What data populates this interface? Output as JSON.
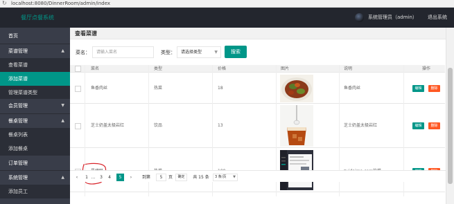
{
  "browser": {
    "url": "localhost:8080/DinnerRoom/admin/index"
  },
  "header": {
    "logo": "餐厅点餐系统",
    "user": "系统管理员（admin）",
    "logout": "退出系统"
  },
  "sidebar": {
    "items": [
      {
        "label": "首页",
        "type": "group",
        "caret": ""
      },
      {
        "label": "菜谱管理",
        "type": "group",
        "caret": "▲"
      },
      {
        "label": "查看菜谱",
        "type": "sub",
        "caret": ""
      },
      {
        "label": "添加菜谱",
        "type": "active",
        "caret": ""
      },
      {
        "label": "管理菜谱类型",
        "type": "sub",
        "caret": ""
      },
      {
        "label": "会员管理",
        "type": "group",
        "caret": "▼"
      },
      {
        "label": "餐桌管理",
        "type": "group",
        "caret": "▲"
      },
      {
        "label": "餐桌列表",
        "type": "sub",
        "caret": ""
      },
      {
        "label": "添加餐桌",
        "type": "sub",
        "caret": ""
      },
      {
        "label": "订单管理",
        "type": "group",
        "caret": ""
      },
      {
        "label": "系统管理",
        "type": "group",
        "caret": "▲"
      },
      {
        "label": "添加员工",
        "type": "sub",
        "caret": ""
      }
    ]
  },
  "page": {
    "title": "查看菜谱"
  },
  "search": {
    "name_label": "菜名：",
    "name_placeholder": "请输入菜名",
    "type_label": "类型：",
    "type_value": "请选择类型",
    "button": "搜索"
  },
  "table": {
    "columns": [
      "菜名",
      "类型",
      "价格",
      "图片",
      "说明",
      "操作"
    ],
    "rows": [
      {
        "name": "鱼香肉丝",
        "type": "热菜",
        "price": "18",
        "image": "fish-flavored-pork-photo",
        "desc": "鱼香肉丝",
        "edit": "编辑",
        "del": "删除"
      },
      {
        "name": "芝士奶盖太极岩红",
        "type": "饮品",
        "price": "13",
        "image": "cheese-tea-drink-photo",
        "desc": "芝士奶盖太极岩红",
        "edit": "编辑",
        "del": "删除"
      },
      {
        "name": "最代码",
        "type": "热菜",
        "price": "100",
        "image": "zuidaima-website-screenshot",
        "desc": "zuidaima.com的菜",
        "edit": "编辑",
        "del": "删除"
      }
    ]
  },
  "pager": {
    "p1": "1",
    "ellipsis": "...",
    "p3": "3",
    "p4": "4",
    "current": "5",
    "next": "›",
    "goto": "到第",
    "goto_value": "5",
    "page_unit": "页",
    "confirm": "确定",
    "total": "共 15 条",
    "size": "3 条/页"
  },
  "colors": {
    "accent": "#009688",
    "danger": "#ff5722",
    "sidebar": "#393d49",
    "header": "#23262e"
  }
}
